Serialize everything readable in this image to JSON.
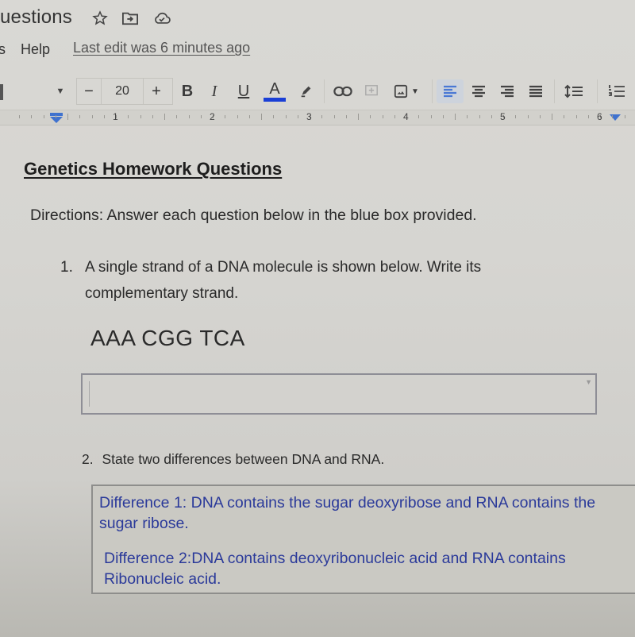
{
  "header": {
    "doc_title": "uestions",
    "star_icon": "star-icon",
    "move_icon": "folder-move-icon",
    "cloud_icon": "cloud-saved-icon",
    "menu": [
      "s",
      "Help"
    ],
    "last_edit": "Last edit was 6 minutes ago"
  },
  "toolbar": {
    "font_size": "20",
    "decrease": "−",
    "increase": "+",
    "bold": "B",
    "italic": "I",
    "underline": "U",
    "text_color_label": "A",
    "text_color": "#1a3fd6",
    "accent_active": "#4a78d4"
  },
  "ruler": {
    "labels": [
      "1",
      "2",
      "3",
      "4",
      "5",
      "6"
    ]
  },
  "document": {
    "heading": "Genetics Homework Questions",
    "directions": "Directions: Answer each question below in the blue box provided.",
    "questions": [
      {
        "number": "1.",
        "text": "A single strand of a DNA molecule is shown below. Write its complementary strand.",
        "strand": "AAA CGG TCA",
        "answer": ""
      },
      {
        "number": "2.",
        "text": "State two differences between DNA and RNA.",
        "answers": [
          "Difference 1: DNA contains the sugar deoxyribose and RNA contains the sugar ribose.",
          "Difference 2:DNA contains deoxyribonucleic acid and RNA contains Ribonucleic acid."
        ]
      }
    ]
  }
}
